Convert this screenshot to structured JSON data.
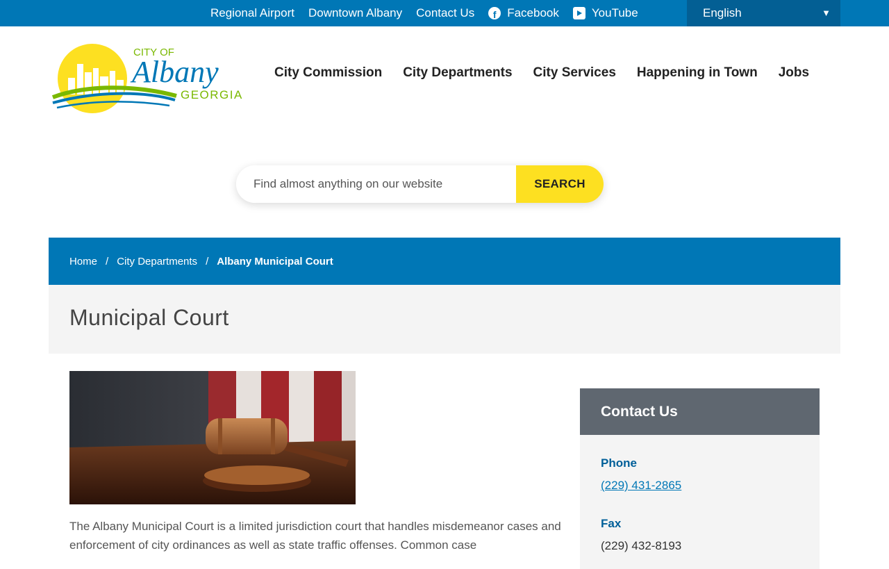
{
  "topbar": {
    "links": {
      "airport": "Regional Airport",
      "downtown": "Downtown Albany",
      "contact": "Contact Us",
      "facebook": "Facebook",
      "youtube": "YouTube"
    },
    "language": "English",
    "color": "#0077b6"
  },
  "logo": {
    "city_of": "CITY OF",
    "name": "Albany",
    "state": "GEORGIA"
  },
  "nav": {
    "commission": "City Commission",
    "departments": "City Departments",
    "services": "City Services",
    "happening": "Happening in Town",
    "jobs": "Jobs"
  },
  "search": {
    "placeholder": "Find almost anything on our website",
    "button": "SEARCH",
    "button_color": "#fde021"
  },
  "breadcrumb": {
    "home": "Home",
    "sep": "/",
    "departments": "City Departments",
    "current": "Albany Municipal Court"
  },
  "page": {
    "title": "Municipal Court",
    "hero_icon": "gavel-image",
    "body": "The Albany Municipal Court is a limited jurisdiction court that handles misdemeanor cases and enforcement of city ordinances as well as state traffic offenses. Common case"
  },
  "contact": {
    "heading": "Contact Us",
    "phone_label": "Phone",
    "phone": "(229) 431-2865",
    "fax_label": "Fax",
    "fax": "(229) 432-8193"
  }
}
